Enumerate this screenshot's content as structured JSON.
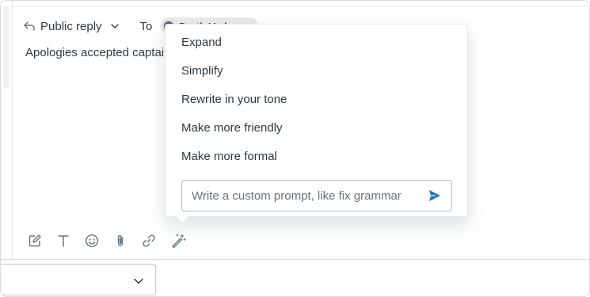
{
  "reply": {
    "type_label": "Public reply",
    "to_label": "To",
    "recipient_name": "Darth Vader"
  },
  "editor": {
    "message_text": "Apologies accepted captain"
  },
  "ai_menu": {
    "items": [
      {
        "label": "Expand"
      },
      {
        "label": "Simplify"
      },
      {
        "label": "Rewrite in your tone"
      },
      {
        "label": "Make more friendly"
      },
      {
        "label": "Make more formal"
      }
    ],
    "prompt_placeholder": "Write a custom prompt, like fix grammar"
  },
  "toolbar": {
    "icons": [
      "compose-icon",
      "text-format-icon",
      "emoji-icon",
      "attachment-icon",
      "link-icon",
      "magic-wand-icon"
    ]
  },
  "colors": {
    "send_accent": "#1f73b7",
    "text": "#2f3941",
    "icon": "#68737d"
  }
}
